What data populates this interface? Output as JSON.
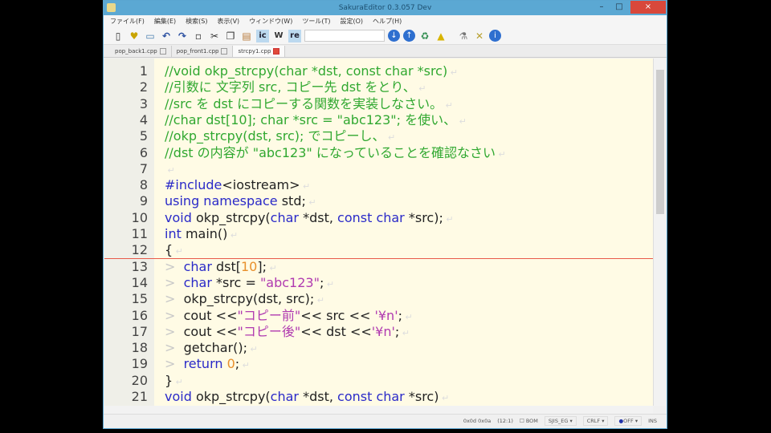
{
  "window": {
    "title": "SakuraEditor 0.3.057 Dev",
    "minimize": "–",
    "maximize": "□",
    "close": "×"
  },
  "menu": [
    "ファイル(F)",
    "編集(E)",
    "検索(S)",
    "表示(V)",
    "ウィンドウ(W)",
    "ツール(T)",
    "設定(O)",
    "ヘルプ(H)"
  ],
  "toolbar": {
    "search_value": "",
    "toggle_labels": [
      "ic",
      "W",
      "re"
    ]
  },
  "tabs": [
    {
      "label": "pop_back1.cpp",
      "active": false
    },
    {
      "label": "pop_front1.cpp",
      "active": false
    },
    {
      "label": "strcpy1.cpp",
      "active": true
    }
  ],
  "editor": {
    "cursor_line": 12,
    "lines": [
      {
        "n": "1",
        "t": [
          [
            "comment",
            "//void okp_strcpy(char *dst, const char *src)"
          ]
        ]
      },
      {
        "n": "2",
        "t": [
          [
            "comment",
            "//引数に 文字列 src, コピー先 dst をとり、"
          ]
        ]
      },
      {
        "n": "3",
        "t": [
          [
            "comment",
            "//src を dst にコピーする関数を実装しなさい。"
          ]
        ]
      },
      {
        "n": "4",
        "t": [
          [
            "comment",
            "//char dst[10]; char *src = \"abc123\"; を使い、"
          ]
        ]
      },
      {
        "n": "5",
        "t": [
          [
            "comment",
            "//okp_strcpy(dst, src); でコピーし、"
          ]
        ]
      },
      {
        "n": "6",
        "t": [
          [
            "comment",
            "//dst の内容が \"abc123\" になっていることを確認なさい"
          ]
        ]
      },
      {
        "n": "7",
        "t": []
      },
      {
        "n": "8",
        "t": [
          [
            "pp",
            "#include"
          ],
          [
            "plain",
            "<iostream>"
          ]
        ]
      },
      {
        "n": "9",
        "t": [
          [
            "kw",
            "using namespace"
          ],
          [
            "plain",
            " std;"
          ]
        ]
      },
      {
        "n": "10",
        "t": [
          [
            "kw",
            "void"
          ],
          [
            "plain",
            " okp_strcpy("
          ],
          [
            "kw",
            "char"
          ],
          [
            "plain",
            " *dst, "
          ],
          [
            "kw",
            "const char"
          ],
          [
            "plain",
            " *src);"
          ]
        ]
      },
      {
        "n": "11",
        "t": [
          [
            "kw",
            "int"
          ],
          [
            "plain",
            " main()"
          ]
        ]
      },
      {
        "n": "12",
        "t": [
          [
            "plain",
            "{"
          ]
        ]
      },
      {
        "n": "13",
        "t": [
          [
            "tab",
            ">  "
          ],
          [
            "kw",
            "char"
          ],
          [
            "plain",
            " dst["
          ],
          [
            "num",
            "10"
          ],
          [
            "plain",
            "];"
          ]
        ]
      },
      {
        "n": "14",
        "t": [
          [
            "tab",
            ">  "
          ],
          [
            "kw",
            "char"
          ],
          [
            "plain",
            " *src = "
          ],
          [
            "str",
            "\"abc123\""
          ],
          [
            "plain",
            ";"
          ]
        ]
      },
      {
        "n": "15",
        "t": [
          [
            "tab",
            ">  "
          ],
          [
            "plain",
            "okp_strcpy(dst, src);"
          ]
        ]
      },
      {
        "n": "16",
        "t": [
          [
            "tab",
            ">  "
          ],
          [
            "plain",
            "cout <<"
          ],
          [
            "str",
            "\"コピー前\""
          ],
          [
            "plain",
            "<< src << "
          ],
          [
            "str",
            "'¥n'"
          ],
          [
            "plain",
            ";"
          ]
        ]
      },
      {
        "n": "17",
        "t": [
          [
            "tab",
            ">  "
          ],
          [
            "plain",
            "cout <<"
          ],
          [
            "str",
            "\"コピー後\""
          ],
          [
            "plain",
            "<< dst <<"
          ],
          [
            "str",
            "'¥n'"
          ],
          [
            "plain",
            ";"
          ]
        ]
      },
      {
        "n": "18",
        "t": [
          [
            "tab",
            ">  "
          ],
          [
            "plain",
            "getchar();"
          ]
        ]
      },
      {
        "n": "19",
        "t": [
          [
            "tab",
            ">  "
          ],
          [
            "kw",
            "return"
          ],
          [
            "plain",
            " "
          ],
          [
            "num",
            "0"
          ],
          [
            "plain",
            ";"
          ]
        ]
      },
      {
        "n": "20",
        "t": [
          [
            "plain",
            "}"
          ]
        ]
      },
      {
        "n": "21",
        "t": [
          [
            "kw",
            "void"
          ],
          [
            "plain",
            " okp_strcpy("
          ],
          [
            "kw",
            "char"
          ],
          [
            "plain",
            " *dst, "
          ],
          [
            "kw",
            "const char"
          ],
          [
            "plain",
            " *src)"
          ]
        ]
      }
    ]
  },
  "status": {
    "char_code": "0x0d 0x0a",
    "position": "(12:1)",
    "bom": "BOM",
    "encoding": "SJIS_EG",
    "eol": "CRLF",
    "ime": "OFF",
    "mode": "INS"
  },
  "colors": {
    "comment": "#30a830",
    "keyword": "#2a2ac8",
    "number": "#e8902c",
    "string": "#b03ab0",
    "background": "#fffbe5",
    "titlebar": "#5ba8d3"
  }
}
